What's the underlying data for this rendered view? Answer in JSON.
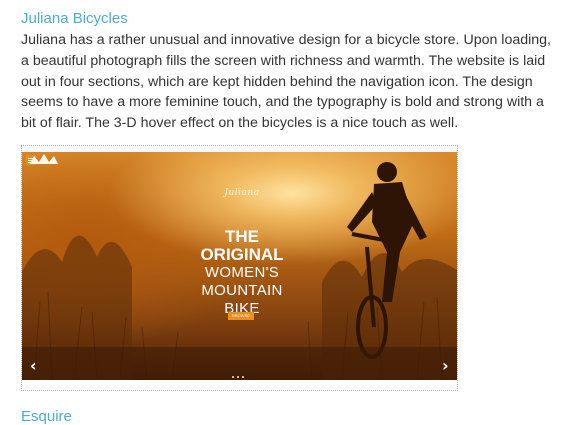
{
  "article": {
    "title": "Juliana Bicycles",
    "body": "Juliana has a rather unusual and innovative design for a bicycle store. Upon loading, a beautiful photograph fills the screen with richness and warmth. The website is laid out in four sections, which are kept hidden behind the navigation icon. The design seems to have a more feminine touch, and the typography is bold and strong with a bit of flair. The 3-D hover effect on the bicycles is a nice touch as well."
  },
  "screenshot": {
    "logo_text": "Juliana",
    "headline": {
      "line1": "THE",
      "line2": "ORIGINAL",
      "line3": "WOMEN'S",
      "line4": "MOUNTAIN",
      "line5": "BIKE"
    },
    "cta_label": "BROWSE",
    "prev_arrow": "‹",
    "next_arrow": "›",
    "slide_count": 3,
    "icons": [
      "hamburger-menu-icon",
      "crown-icon",
      "chevron-left-icon",
      "chevron-right-icon"
    ],
    "accent_color": "#ea8e21"
  },
  "next_article": {
    "title": "Esquire"
  },
  "colors": {
    "link": "#4ea9cf",
    "body_text": "#333333"
  }
}
